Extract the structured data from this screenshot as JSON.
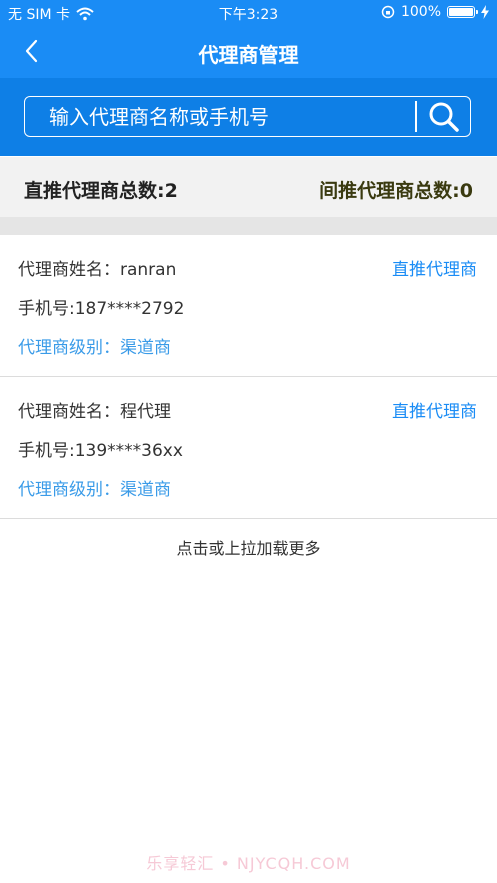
{
  "status": {
    "carrier": "无 SIM 卡",
    "time": "下午3:23",
    "battery": "100%"
  },
  "nav": {
    "title": "代理商管理"
  },
  "search": {
    "placeholder": "输入代理商名称或手机号"
  },
  "counts": {
    "direct": "直推代理商总数:2",
    "indirect": "间推代理商总数:0"
  },
  "agents": [
    {
      "name": "代理商姓名：ranran",
      "type": "直推代理商",
      "phone": "手机号:187****2792",
      "level": "代理商级别：渠道商"
    },
    {
      "name": "代理商姓名：程代理",
      "type": "直推代理商",
      "phone": "手机号:139****36xx",
      "level": "代理商级别：渠道商"
    }
  ],
  "load_more": "点击或上拉加载更多",
  "watermark": "乐享轻汇 • NJYCQH.COM",
  "icons": {
    "back": "chevron-left-icon",
    "search": "search-icon",
    "wifi": "wifi-icon",
    "lock": "rotation-lock-icon",
    "battery": "battery-icon",
    "charging": "charging-icon"
  },
  "colors": {
    "primary": "#1a8cf5",
    "search_band": "#0e7fe6",
    "link": "#1a8cf5"
  }
}
